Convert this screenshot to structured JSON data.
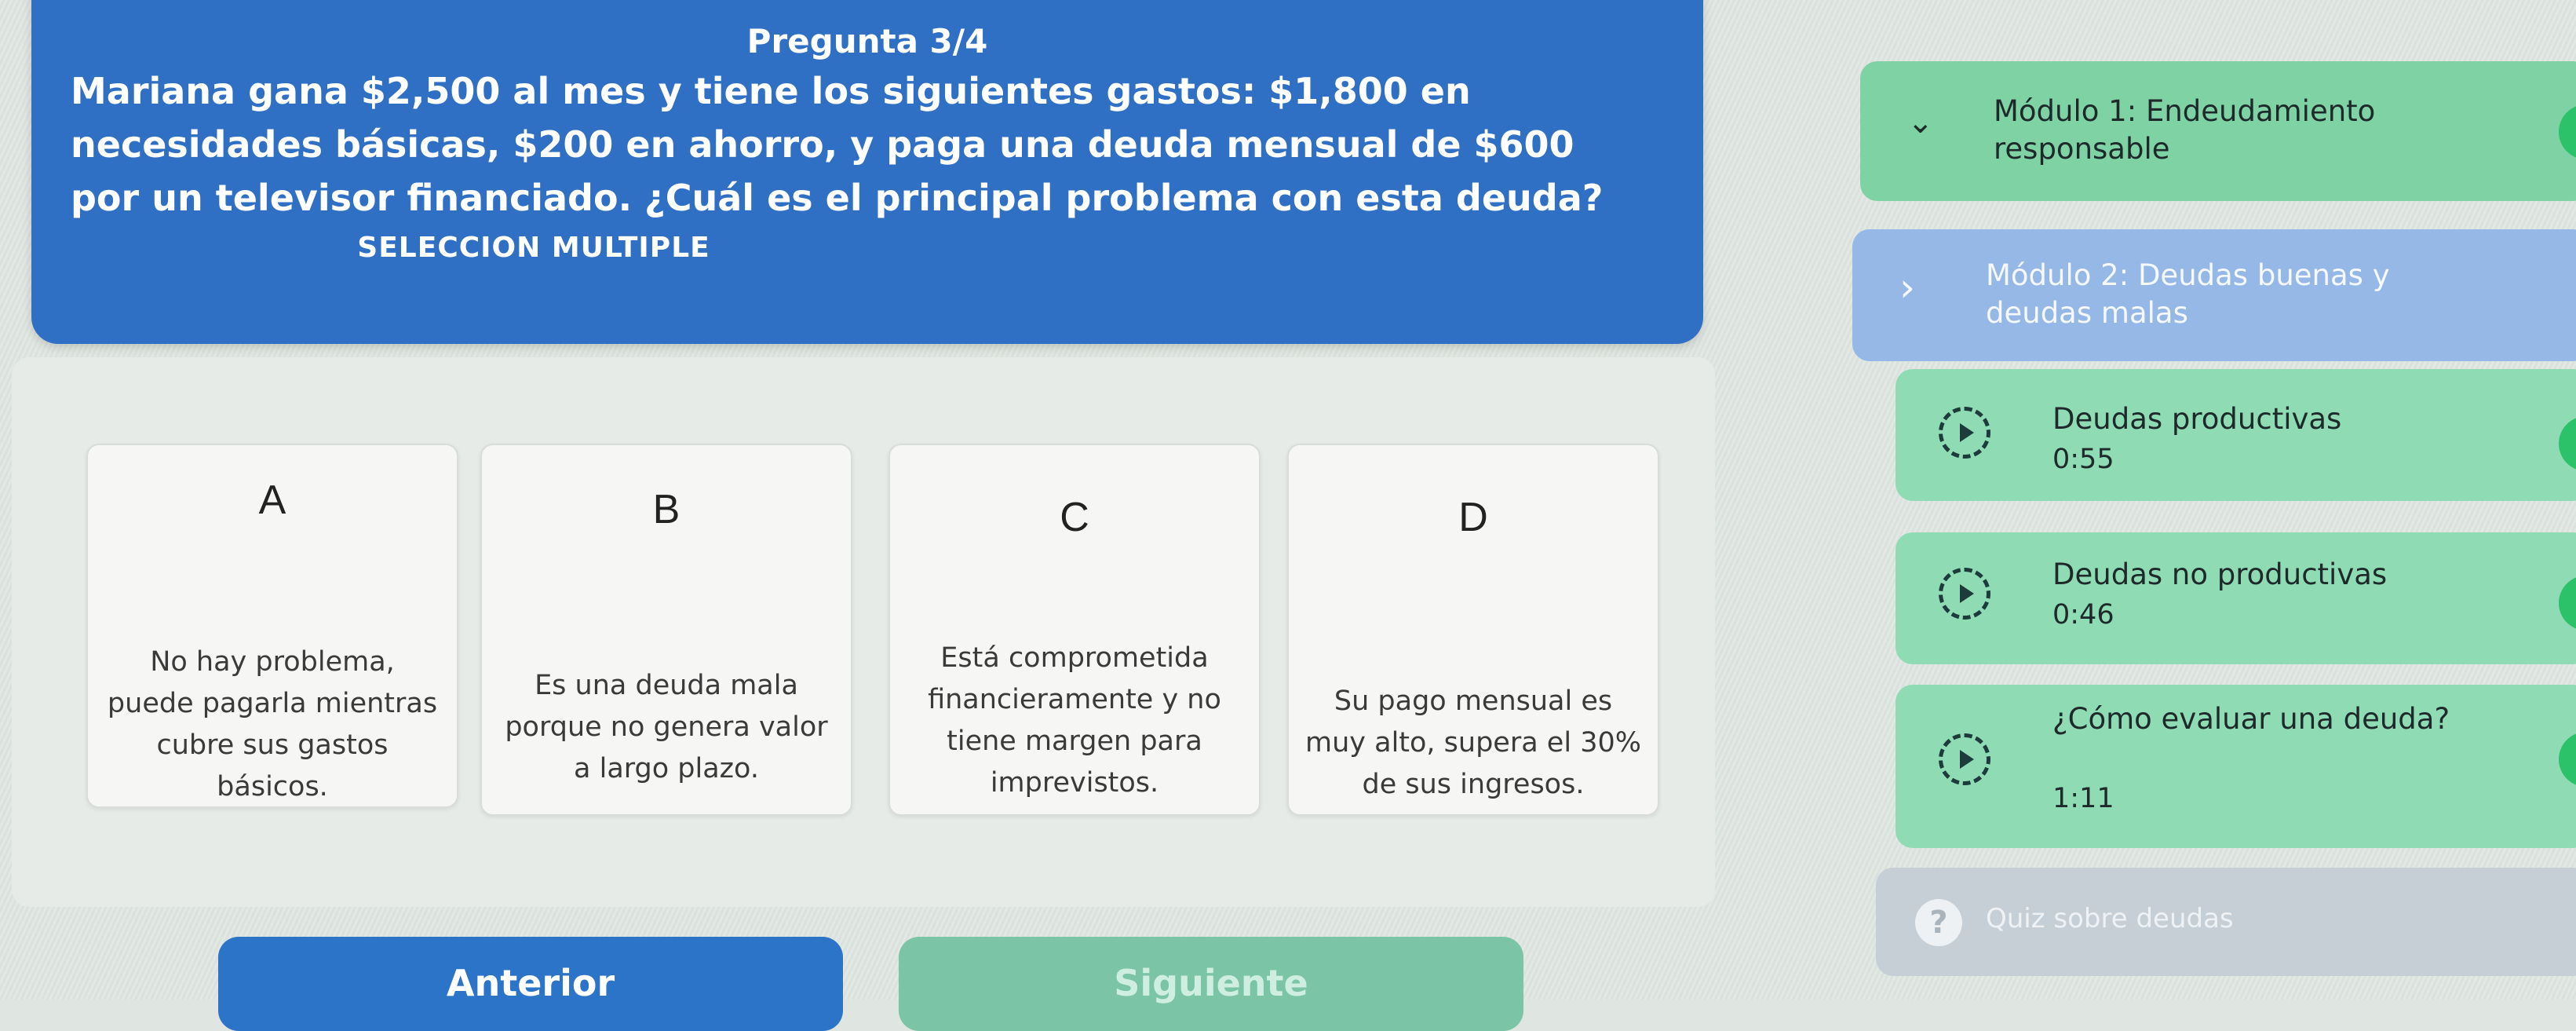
{
  "question": {
    "counter": "Pregunta 3/4",
    "text": "Mariana gana $2,500 al mes y tiene los siguientes gastos: $1,800 en necesidades básicas, $200 en ahorro, y paga una deuda mensual de $600 por un televisor financiado. ¿Cuál es el principal problema con esta deuda?",
    "type_label": "SELECCION MULTIPLE"
  },
  "options": [
    {
      "letter": "A",
      "text": "No hay problema, puede pagarla mientras cubre sus gastos básicos."
    },
    {
      "letter": "B",
      "text": "Es una deuda mala porque no genera valor a largo plazo."
    },
    {
      "letter": "C",
      "text": "Está comprometida financieramente y no tiene margen para imprevistos."
    },
    {
      "letter": "D",
      "text": "Su pago mensual es muy alto, supera el 30% de sus ingresos."
    }
  ],
  "navigation": {
    "prev_label": "Anterior",
    "next_label": "Siguiente"
  },
  "sidebar": {
    "modules": [
      {
        "title": "Módulo 1: Endeudamiento responsable",
        "expanded": true,
        "completed": true
      },
      {
        "title": "Módulo 2: Deudas buenas y deudas malas",
        "expanded": false
      }
    ],
    "lessons": [
      {
        "title": "Deudas productivas",
        "duration": "0:55",
        "completed": true
      },
      {
        "title": "Deudas no productivas",
        "duration": "0:46",
        "completed": true
      },
      {
        "title": "¿Cómo evaluar una deuda?",
        "duration": "1:11",
        "completed": true
      }
    ],
    "quiz": {
      "label": "Quiz sobre deudas"
    }
  },
  "icons": {
    "check": "check-icon",
    "play": "play-icon",
    "chevron_down": "chevron-down-icon",
    "chevron_right": "chevron-right-icon",
    "question": "question-icon"
  },
  "colors": {
    "question_card": "#2f6fc4",
    "completed_lesson": "#8fdcb4",
    "check_badge": "#2bc26a",
    "prev_button": "#2b74c8",
    "next_button": "#7bc4a5"
  }
}
